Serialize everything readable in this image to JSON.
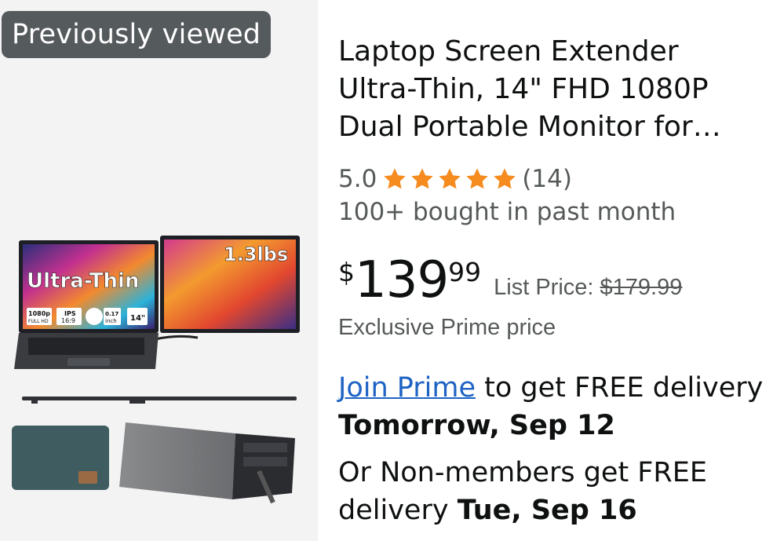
{
  "badge": {
    "label": "Previously viewed"
  },
  "product": {
    "image_alt": "Laptop screen extender product image",
    "image_texts": {
      "ultra_thin": "Ultra-Thin",
      "weight": "1.3lbs",
      "res_top": "1080p",
      "res_bottom": "FULL HD",
      "panel_top": "IPS",
      "panel_bottom": "16:9",
      "thickness_top": "0.17",
      "thickness_bottom": "inch",
      "size": "14\""
    },
    "title": "Laptop Screen Extender Ultra-Thin, 14\" FHD 1080P Dual Portable Monitor for…",
    "rating": {
      "value": "5.0",
      "count": "(14)",
      "stars": 5,
      "star_color": "#f68b1f"
    },
    "bought": "100+ bought in past month",
    "price": {
      "currency": "$",
      "whole": "139",
      "fraction": "99",
      "list_label": "List Price:",
      "list_value": "$179.99"
    },
    "exclusive": "Exclusive Prime price",
    "delivery_prime": {
      "link": "Join Prime",
      "text": " to get FREE delivery ",
      "date": "Tomorrow, Sep 12"
    },
    "delivery_nonmember": {
      "text": "Or Non-members get FREE delivery ",
      "date": "Tue, Sep 16"
    }
  },
  "colors": {
    "link": "#1e63c4",
    "badge_bg": "#555a5d",
    "panel_bg": "#f3f3f3"
  }
}
